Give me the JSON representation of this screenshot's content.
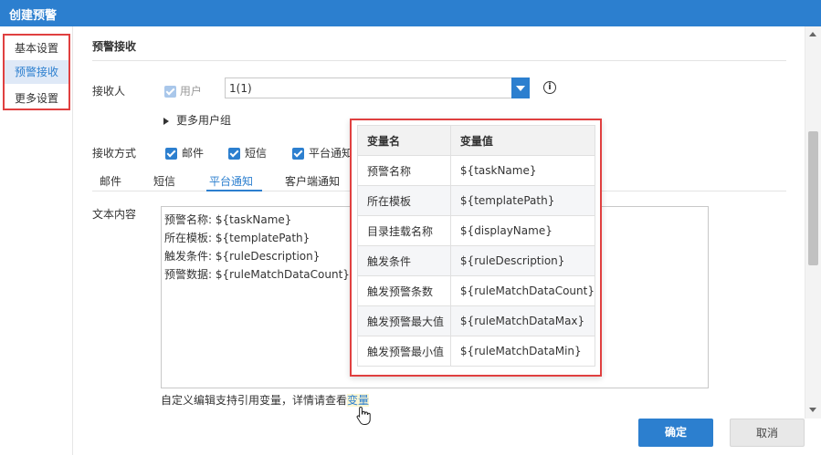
{
  "window": {
    "title": "创建预警"
  },
  "leftnav": {
    "items": [
      {
        "label": "基本设置"
      },
      {
        "label": "预警接收"
      },
      {
        "label": "更多设置"
      }
    ]
  },
  "section": {
    "title": "预警接收"
  },
  "receiver": {
    "label": "接收人",
    "user_checkbox_label": "用户",
    "combo_value": "1(1)",
    "more_group": "更多用户组"
  },
  "method": {
    "label": "接收方式",
    "options": [
      {
        "label": "邮件"
      },
      {
        "label": "短信"
      },
      {
        "label": "平台通知"
      }
    ]
  },
  "tabs": [
    {
      "label": "邮件"
    },
    {
      "label": "短信"
    },
    {
      "label": "平台通知"
    },
    {
      "label": "客户端通知"
    }
  ],
  "content": {
    "label": "文本内容",
    "lines": [
      "预警名称: ${taskName}",
      "所在模板: ${templatePath}",
      "触发条件: ${ruleDescription}",
      "预警数据: ${ruleMatchDataCount}条数"
    ]
  },
  "hint": {
    "text": "自定义编辑支持引用变量，详情请查看",
    "link": "变量"
  },
  "buttons": {
    "ok": "确定",
    "cancel": "取消"
  },
  "popup": {
    "headers": [
      "变量名",
      "变量值"
    ],
    "rows": [
      [
        "预警名称",
        "${taskName}"
      ],
      [
        "所在模板",
        "${templatePath}"
      ],
      [
        "目录挂载名称",
        "${displayName}"
      ],
      [
        "触发条件",
        "${ruleDescription}"
      ],
      [
        "触发预警条数",
        "${ruleMatchDataCount}"
      ],
      [
        "触发预警最大值",
        "${ruleMatchDataMax}"
      ],
      [
        "触发预警最小值",
        "${ruleMatchDataMin}"
      ]
    ]
  },
  "colors": {
    "primary": "#2c7fcf",
    "highlight_border": "#e04040"
  }
}
